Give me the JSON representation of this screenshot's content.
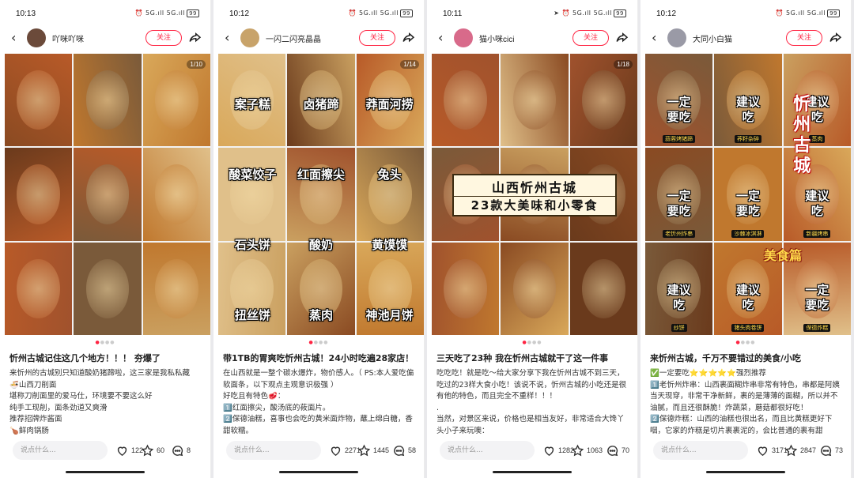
{
  "panels": [
    {
      "time": "10:13",
      "signal": "⏰ 5G.ıll 5G.ıll",
      "battery": "99",
      "username": "吖咪吖咪",
      "follow": "关注",
      "page_counter": "1/10",
      "labels": [],
      "title": "忻州古城记住这几个地方！！！ 夯爆了",
      "body": "来忻州的古城别只知道酸奶猪蹄啦，这三家是我私私藏\n🍜山西刀削面\n堪称刀削面里的爱马仕，环境要不要这么好\n纯手工现削，面条劲道又爽滑\n推荐招牌炸酱面\n🍗鲜肉锅肠",
      "comment_placeholder": "说点什么...",
      "likes": "122",
      "stars": "60",
      "comments": "8",
      "avatar_color": "#6b4a3a"
    },
    {
      "time": "10:12",
      "signal": "⏰ 5G.ıll 5G.ıll",
      "battery": "99",
      "username": "一闪二闪亮晶晶",
      "follow": "关注",
      "page_counter": "1/14",
      "labels": [
        "案子糕",
        "卤猪蹄",
        "莽面河捞",
        "酸菜饺子",
        "红面擦尖",
        "兔头",
        "石头饼",
        "酸奶",
        "黄馍馍",
        "扭丝饼",
        "蒸肉",
        "神池月饼"
      ],
      "title": "带1TB的胃爽吃忻州古城！24小时吃遍28家店！",
      "body": "在山西就是一整个碳水爆炸，物价感人。（ PS:本人爱吃偏软面条，以下观点主观意识极强 ）\n好吃且有特色🥩：\n1️⃣红面擦尖，酸汤底的莜面片。\n2️⃣保德油糕，喜事也会吃的黄米面炸物，蘸上绵白糖，香甜软糯。",
      "comment_placeholder": "说点什么...",
      "likes": "2271",
      "stars": "1445",
      "comments": "58",
      "avatar_color": "#c8a36a"
    },
    {
      "time": "10:11",
      "signal": "➤ ⏰ 5G.ıll 5G.ıll",
      "battery": "99",
      "username": "猫小咪cici",
      "follow": "关注",
      "page_counter": "1/18",
      "banner_line1": "山西忻州古城",
      "banner_line2": "23款大美味和小零食",
      "labels": [],
      "title": "三天吃了23种 我在忻州古城就干了这一件事",
      "body": "吃吃吃！就是吃～给大家分享下我在忻州古城不到三天，吃过的23样大食小吃！该说不说，忻州古城的小吃还是很有他的特色，而且完全不重样！！！\n.\n当然，对景区来说，价格也是相当友好，非常适合大馋丫头小子来玩噢：",
      "comment_placeholder": "说点什么...",
      "likes": "1282",
      "stars": "1063",
      "comments": "70",
      "avatar_color": "#d86a8a"
    },
    {
      "time": "10:12",
      "signal": "⏰ 5G.ıll 5G.ıll",
      "battery": "99",
      "username": "大同小白猫",
      "follow": "关注",
      "vertical_title": "忻州古城",
      "food_title": "美食篇",
      "stamps": [
        {
          "big": "一定\n要吃",
          "small": "蒜蓉烤猪蹄"
        },
        {
          "big": "建议\n吃",
          "small": "荞籽杂碎"
        },
        {
          "big": "建议\n吃",
          "small": "蒸肉"
        },
        {
          "big": "一定\n要吃",
          "small": "老忻州炸串"
        },
        {
          "big": "一定\n要吃",
          "small": "沙棘冰淇淋"
        },
        {
          "big": "建议\n吃",
          "small": "新疆烤串"
        },
        {
          "big": "建议\n吃",
          "small": "炒饼"
        },
        {
          "big": "建议\n吃",
          "small": "猪头肉卷饼"
        },
        {
          "big": "一定\n要吃",
          "small": "保德炸糕"
        }
      ],
      "title": "来忻州古城，千万不要错过的美食/小吃",
      "body": "✅一定要吃⭐⭐⭐⭐⭐强烈推荐\n1️⃣老忻州炸串：山西裹面糊炸串非常有特色，串都是阿姨当天现穿，非常干净新鲜，裹的是薄薄的面糊，所以并不油腻，而且还很酥脆！炸蔬菜，蘑菇都很好吃！\n2️⃣保德炸糕：山西的油糕也很出名，而且比黄糕更好下咽，它家的炸糕是切片裹裹泥的，会比普通的裹有甜",
      "comment_placeholder": "说点什么...",
      "likes": "3171",
      "stars": "2847",
      "comments": "73",
      "avatar_color": "#9a9aa6"
    }
  ],
  "food_palette": [
    "#8a4a22",
    "#c0782e",
    "#d9a85a",
    "#6a3a1c",
    "#b85a28",
    "#e0c08a",
    "#a0522d",
    "#7a5a3a",
    "#caa060"
  ],
  "accent": "#ff2442"
}
